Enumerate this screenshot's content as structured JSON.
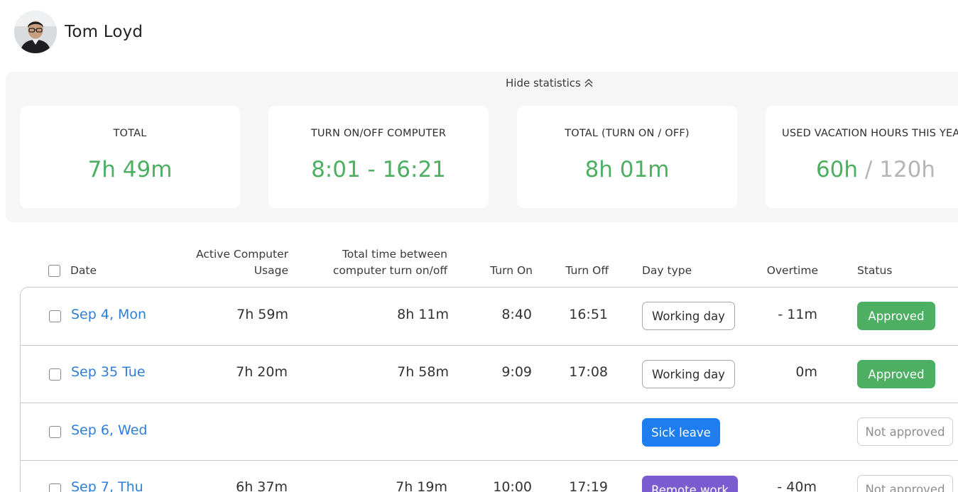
{
  "user": {
    "name": "Tom Loyd"
  },
  "statistics": {
    "toggle_label": "Hide statistics",
    "toggle_icon": "double-chevron-up-icon",
    "cards": [
      {
        "title": "TOTAL",
        "value": "7h 49m"
      },
      {
        "title": "TURN ON/OFF COMPUTER",
        "value": "8:01 - 16:21"
      },
      {
        "title": "TOTAL (TURN ON / OFF)",
        "value": "8h 01m"
      },
      {
        "title": "USED VACATION HOURS THIS YEAR",
        "value_used": "60h",
        "separator": "/",
        "value_total": "120h"
      }
    ]
  },
  "table": {
    "headers": {
      "date": "Date",
      "active_usage_line1": "Active Computer",
      "active_usage_line2": "Usage",
      "total_between_line1": "Total time between",
      "total_between_line2": "computer turn on/off",
      "turn_on": "Turn On",
      "turn_off": "Turn Off",
      "day_type": "Day type",
      "overtime": "Overtime",
      "status": "Status"
    },
    "rows": [
      {
        "date": "Sep 4, Mon",
        "active": "7h 59m",
        "total": "8h 11m",
        "turn_on": "8:40",
        "turn_off": "16:51",
        "day_type": "Working day",
        "overtime": "- 11m",
        "status": "Approved"
      },
      {
        "date": "Sep  35 Tue",
        "active": "7h 20m",
        "total": "7h 58m",
        "turn_on": "9:09",
        "turn_off": "17:08",
        "day_type": "Working day",
        "overtime": "0m",
        "status": "Approved"
      },
      {
        "date": "Sep 6, Wed",
        "active": "",
        "total": "",
        "turn_on": "",
        "turn_off": "",
        "day_type": "Sick leave",
        "overtime": "",
        "status": "Not approved"
      },
      {
        "date": "Sep 7, Thu",
        "active": "6h 37m",
        "total": "7h 19m",
        "turn_on": "10:00",
        "turn_off": "17:19",
        "day_type": "Remote work",
        "overtime": "- 40m",
        "status": "Not approved"
      }
    ]
  },
  "colors": {
    "accent_green": "#4caf62",
    "link_blue": "#2f7fd8",
    "sick_leave_blue": "#1e7ef0",
    "remote_work_purple": "#7a5cd0",
    "muted_gray": "#b5b5b5"
  }
}
